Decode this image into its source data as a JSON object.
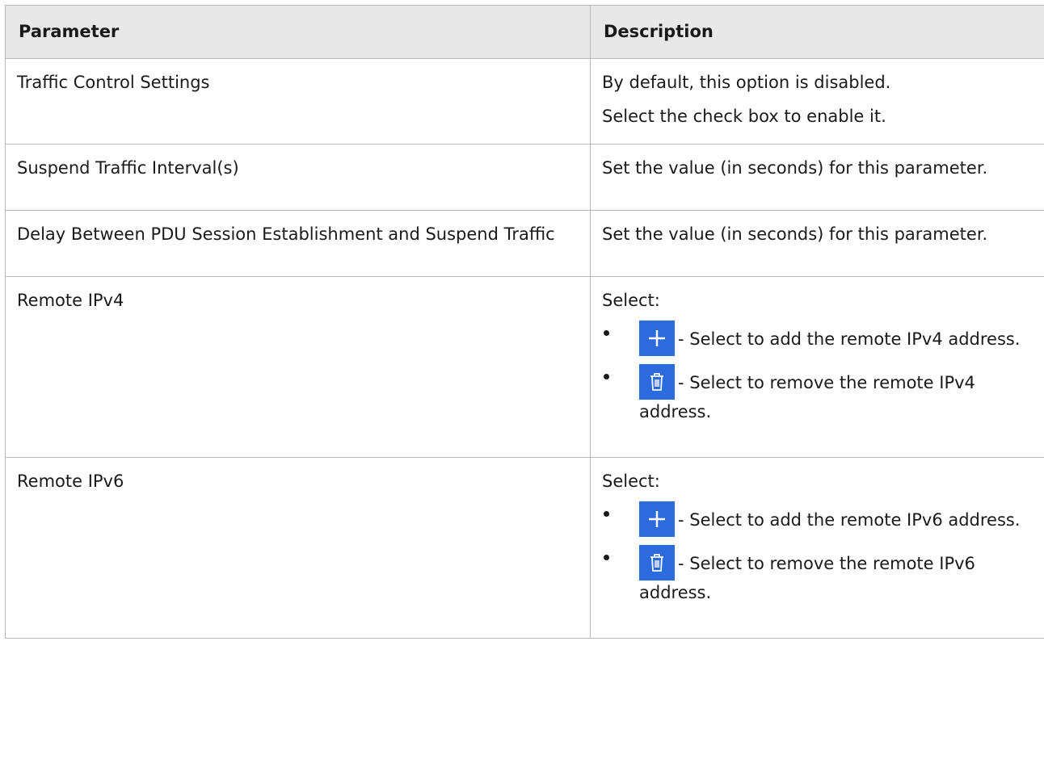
{
  "header": {
    "col1": "Parameter",
    "col2": "Description"
  },
  "rows": [
    {
      "param": "Traffic Control Settings",
      "desc_lines": [
        "By default, this option is disabled.",
        "Select the check box to enable it."
      ]
    },
    {
      "param": "Suspend Traffic Interval(s)",
      "desc": "Set the value (in seconds) for this parameter."
    },
    {
      "param": "Delay Between PDU Session Establishment and Suspend Traffic",
      "desc": "Set the value (in seconds) for this parameter."
    },
    {
      "param": "Remote IPv4",
      "select_label": "Select:",
      "options": [
        {
          "icon": "plus-icon",
          "text": "- Select to add the remote IPv4 address."
        },
        {
          "icon": "trash-icon",
          "text": "- Select to remove the remote IPv4 address."
        }
      ]
    },
    {
      "param": "Remote IPv6",
      "select_label": "Select:",
      "options": [
        {
          "icon": "plus-icon",
          "text": "- Select to add the remote IPv6 address."
        },
        {
          "icon": "trash-icon",
          "text": "- Select to remove the remote IPv6 address."
        }
      ]
    }
  ],
  "colors": {
    "button_blue": "#2b6bde",
    "header_bg": "#e8e8e8",
    "border": "#b8b8b8"
  }
}
